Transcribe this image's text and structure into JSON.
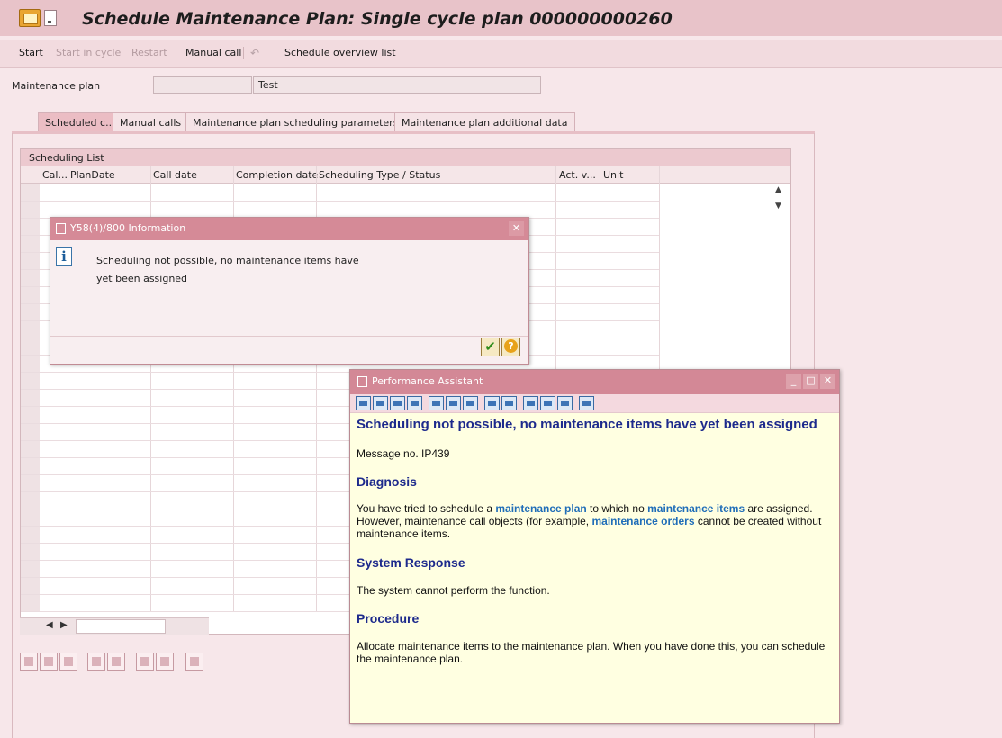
{
  "window": {
    "title": "Schedule Maintenance Plan: Single cycle plan 000000000260"
  },
  "toolbar": {
    "start": "Start",
    "start_in_cycle": "Start in cycle",
    "restart": "Restart",
    "manual_call": "Manual call",
    "schedule_overview": "Schedule overview list"
  },
  "header": {
    "maintenance_plan_label": "Maintenance plan",
    "maintenance_plan_number": "",
    "maintenance_plan_text": "Test"
  },
  "tabs": [
    {
      "label": "Scheduled c...",
      "active": true
    },
    {
      "label": "Manual calls"
    },
    {
      "label": "Maintenance plan scheduling parameters"
    },
    {
      "label": "Maintenance plan additional data"
    }
  ],
  "scheduling_list": {
    "title": "Scheduling List",
    "columns": [
      "Cal...",
      "PlanDate",
      "Call date",
      "Completion date",
      "Scheduling Type / Status",
      "Act. v...",
      "Unit"
    ],
    "rows": []
  },
  "info_dialog": {
    "title": "Y58(4)/800 Information",
    "message_line1": "Scheduling not possible, no maintenance items have",
    "message_line2": "yet been assigned"
  },
  "performance_assistant": {
    "title": "Performance Assistant",
    "heading": "Scheduling not possible, no maintenance items have yet been assigned",
    "message_no": "Message no. IP439",
    "diagnosis_title": "Diagnosis",
    "diagnosis_p1": "You have tried to schedule a ",
    "diagnosis_link1": "maintenance plan",
    "diagnosis_p2": " to which no ",
    "diagnosis_link2": "maintenance items",
    "diagnosis_p3": " are assigned. However, maintenance call objects (for example, ",
    "diagnosis_link3": "maintenance orders",
    "diagnosis_p4": " cannot be created without maintenance items.",
    "system_response_title": "System Response",
    "system_response_text": "The system cannot perform the function.",
    "procedure_title": "Procedure",
    "procedure_text": "Allocate maintenance items to the maintenance plan. When you have done this, you can schedule the maintenance plan."
  },
  "colors": {
    "title_bar": "#e8c3c9",
    "dialog_title": "#d58a97",
    "heading_blue": "#1d2a8c",
    "link_blue": "#1f6db8",
    "assistant_bg": "#ffffe1"
  }
}
